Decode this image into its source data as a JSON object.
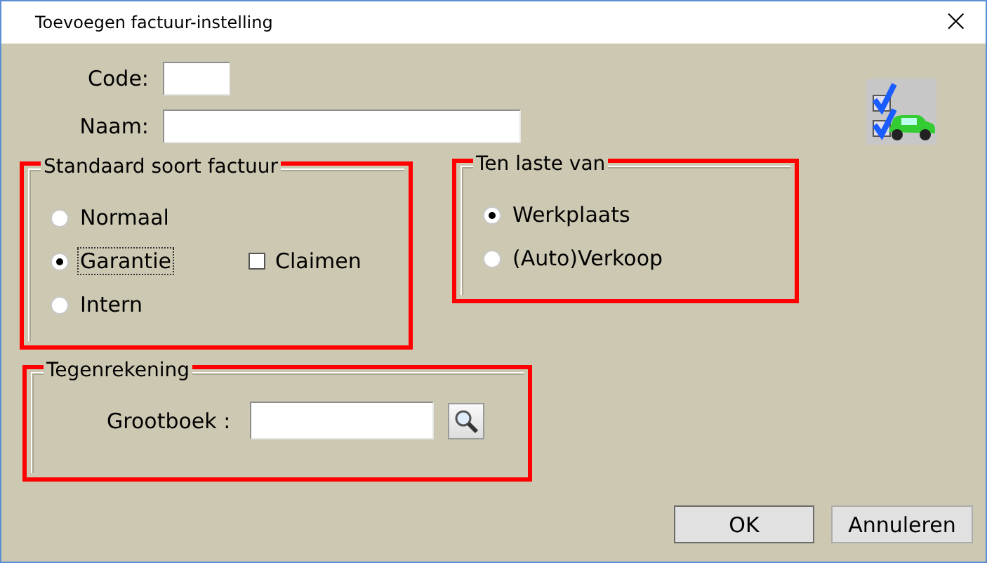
{
  "window": {
    "title": "Toevoegen factuur-instelling",
    "close": "×"
  },
  "fields": [
    {
      "label": "Code:"
    },
    {
      "label": "Naam:"
    }
  ],
  "invoice_type": {
    "title": "Standaard soort factuur",
    "highlighted": true,
    "options": [
      {
        "label": "Normaal",
        "selected": false,
        "focused": false
      },
      {
        "label": "Garantie",
        "selected": true,
        "focused": true
      },
      {
        "label": "Intern",
        "selected": false,
        "focused": false
      }
    ],
    "claim": {
      "label": "Claimen",
      "checked": false
    }
  },
  "charged_to": {
    "title": "Ten laste van",
    "highlighted": true,
    "options": [
      {
        "label": "Werkplaats",
        "selected": true
      },
      {
        "label": "(Auto)Verkoop",
        "selected": false
      }
    ]
  },
  "counter_account": {
    "title": "Tegenrekening",
    "highlighted": true,
    "label": "Grootboek :"
  },
  "buttons": [
    {
      "label": "OK",
      "default": true
    },
    {
      "label": "Annuleren",
      "default": false
    }
  ]
}
